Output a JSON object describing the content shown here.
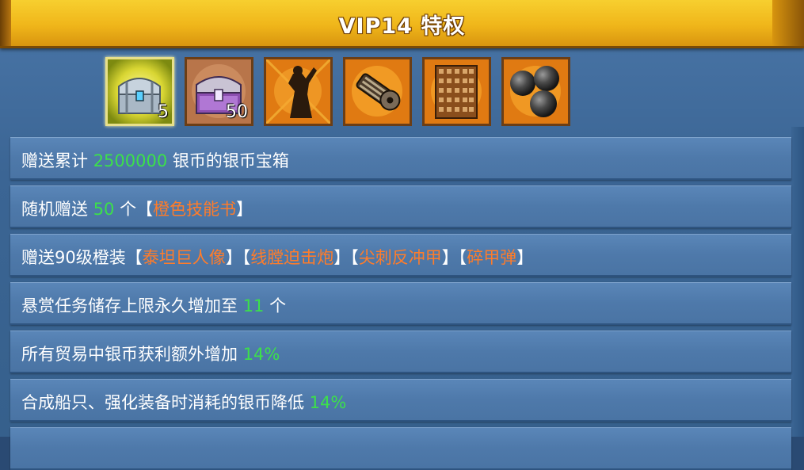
{
  "header": {
    "title": "VIP14 特权"
  },
  "rewards": [
    {
      "icon": "silver-chest-icon",
      "count": "5",
      "selected": true
    },
    {
      "icon": "purple-chest-icon",
      "count": "50"
    },
    {
      "icon": "titan-statue-icon",
      "count": ""
    },
    {
      "icon": "gatling-cannon-icon",
      "count": ""
    },
    {
      "icon": "spiked-armor-icon",
      "count": ""
    },
    {
      "icon": "cannonballs-icon",
      "count": ""
    }
  ],
  "privileges": [
    {
      "parts": [
        "赠送累计 ",
        "2500000",
        " 银币的银币宝箱"
      ]
    },
    {
      "parts": [
        "随机赠送 ",
        "50",
        " 个【",
        "橙色技能书",
        "】"
      ]
    },
    {
      "parts": [
        "赠送90级橙装【",
        "泰坦巨人像",
        "】【",
        "线膛迫击炮",
        "】【",
        "尖刺反冲甲",
        "】【",
        "碎甲弹",
        "】"
      ]
    },
    {
      "parts": [
        "悬赏任务储存上限永久增加至 ",
        "11",
        " 个"
      ]
    },
    {
      "parts": [
        "所有贸易中银币获利额外增加 ",
        "14%"
      ]
    },
    {
      "parts": [
        "合成船只、强化装备时消耗的银币降低 ",
        "14%"
      ]
    }
  ],
  "colors": {
    "highlight_green": "#3ce04a",
    "highlight_orange": "#ff7c2a",
    "header_gold": "#f0b61a"
  }
}
